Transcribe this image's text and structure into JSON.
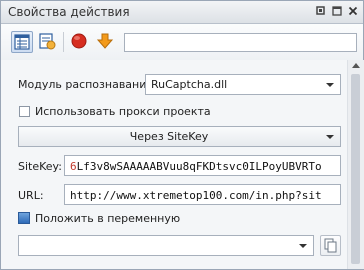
{
  "panel": {
    "title": "Свойства действия",
    "controls": {
      "pin": "pin-icon",
      "maximize": "maximize-icon",
      "close": "close-icon"
    }
  },
  "toolbar": {
    "buttons": [
      "properties-view-icon",
      "action-settings-icon",
      "record-icon",
      "move-down-icon"
    ],
    "filter_value": ""
  },
  "form": {
    "module_label": "Модуль распознавания:",
    "module_value": "RuCaptcha.dll",
    "proxy_label": "Использовать прокси проекта",
    "proxy_checked": false,
    "method_value": "Через SiteKey",
    "sitekey_label": "SiteKey:",
    "sitekey_value": "6Lf3v8wSAAAAABVuu8qFKDtsvc0ILPoyUBVRTo",
    "url_label": "URL:",
    "url_value": "http://www.xtremetop100.com/in.php?sit",
    "save_label": "Положить в переменную",
    "variable_value": ""
  },
  "colors": {
    "accent": "#3a7bd5",
    "border": "#a7b0bc",
    "record_red": "#d62d20",
    "arrow_orange": "#f39a1b",
    "sitekey_first_char": "#c0392b"
  }
}
